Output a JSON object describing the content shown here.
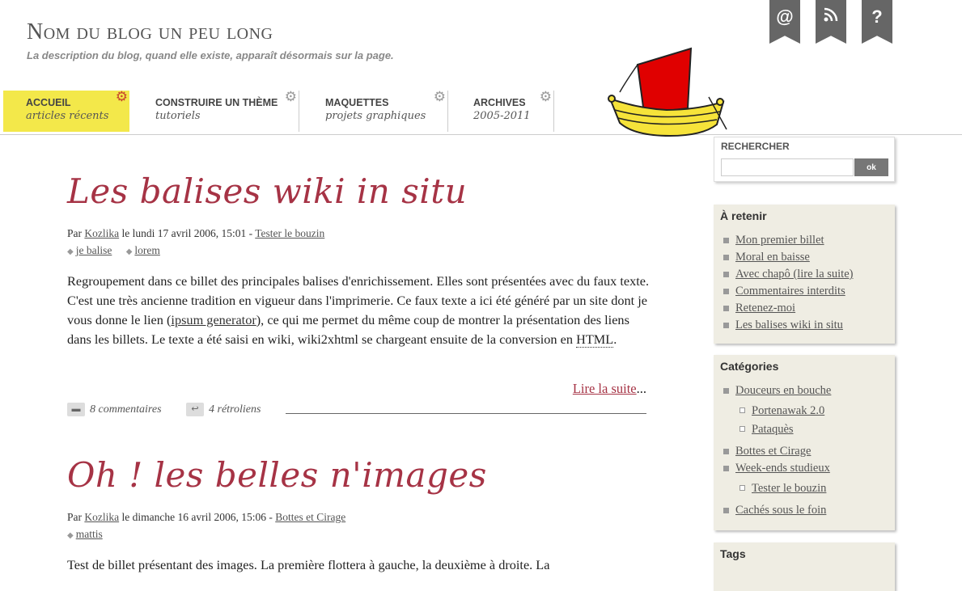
{
  "header": {
    "title": "Nom du blog un peu long",
    "description": "La description du blog, quand elle existe, apparaît désormais sur la page."
  },
  "ribbons": [
    {
      "icon": "at-icon",
      "label": "@"
    },
    {
      "icon": "rss-icon",
      "label": ""
    },
    {
      "icon": "help-icon",
      "label": "?"
    }
  ],
  "nav": {
    "items": [
      {
        "label": "ACCUEIL",
        "sub": "articles récents"
      },
      {
        "label": "CONSTRUIRE UN THÈME",
        "sub": "tutoriels"
      },
      {
        "label": "MAQUETTES",
        "sub": "projets graphiques"
      },
      {
        "label": "ARCHIVES",
        "sub": "2005-2011"
      }
    ]
  },
  "posts": [
    {
      "title": "Les balises wiki in situ",
      "by": "Par",
      "author": "Kozlika",
      "date": "le lundi 17 avril 2006, 15:01 -",
      "category": "Tester le bouzin",
      "tags": [
        "je balise",
        "lorem"
      ],
      "excerpt_1": "Regroupement dans ce billet des principales balises d'enrichissement. Elles sont présentées avec du faux texte. C'est une très ancienne tradition en vigueur dans l'imprimerie. Ce faux texte a ici été généré par un site dont je vous donne le lien (",
      "excerpt_link": "ipsum generator",
      "excerpt_2": "), ce qui me permet du même coup de montrer la présentation des liens dans les billets. Le texte a été saisi en wiki, wiki2xhtml se chargeant ensuite de la conversion en ",
      "excerpt_abbr": "HTML",
      "excerpt_3": ".",
      "readmore": "Lire la suite",
      "readmore_suffix": "...",
      "comments": "8 commentaires",
      "trackbacks": "4 rétroliens"
    },
    {
      "title": "Oh ! les belles n'images",
      "by": "Par",
      "author": "Kozlika",
      "date": "le dimanche 16 avril 2006, 15:06 -",
      "category": "Bottes et Cirage",
      "tags": [
        "mattis"
      ],
      "excerpt": "Test de billet présentant des images. La première flottera à gauche, la deuxième à droite. La"
    }
  ],
  "sidebar": {
    "search": {
      "title": "RECHERCHER",
      "button": "ok",
      "value": ""
    },
    "retenir": {
      "title": "À retenir",
      "items": [
        "Mon premier billet",
        "Moral en baisse",
        "Avec chapô (lire la suite)",
        "Commentaires interdits",
        "Retenez-moi",
        "Les balises wiki in situ"
      ]
    },
    "categories": {
      "title": "Catégories",
      "items": [
        "Douceurs en bouche",
        "Portenawak 2.0",
        "Pataquès",
        "Bottes et Cirage",
        "Week-ends studieux",
        "Tester le bouzin",
        "Cachés sous le foin"
      ]
    },
    "tags": {
      "title": "Tags"
    }
  },
  "colors": {
    "accent": "#a63345",
    "nav_active": "#f3e84a",
    "sail": "#e00000",
    "hull": "#f6e33a"
  }
}
